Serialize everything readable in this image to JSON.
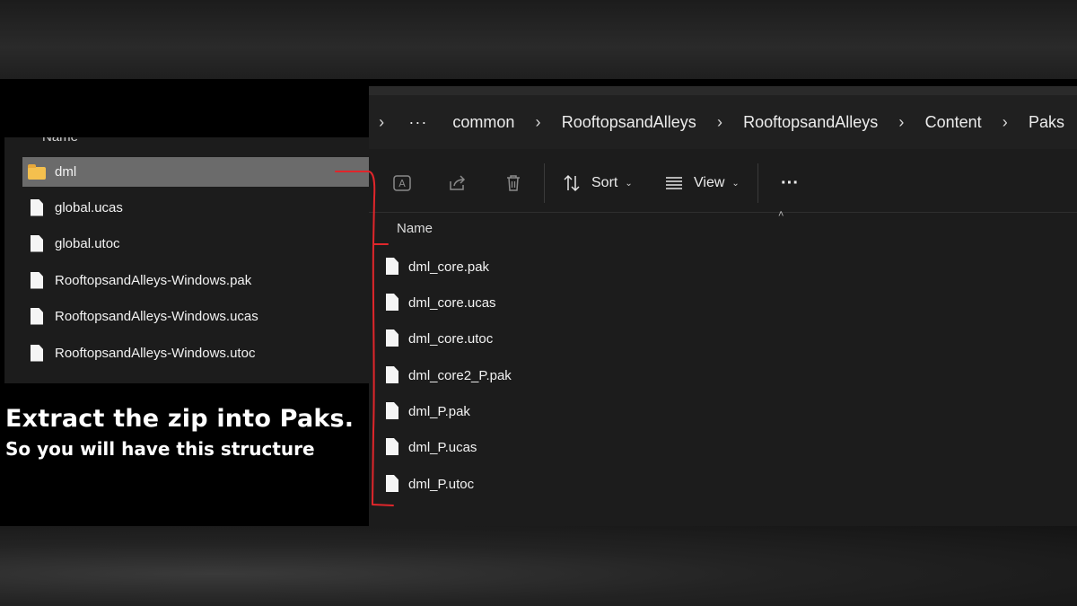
{
  "left_explorer": {
    "column_header": "Name",
    "items": [
      {
        "name": "dml",
        "type": "folder",
        "selected": true
      },
      {
        "name": "global.ucas",
        "type": "file"
      },
      {
        "name": "global.utoc",
        "type": "file"
      },
      {
        "name": "RooftopsandAlleys-Windows.pak",
        "type": "file"
      },
      {
        "name": "RooftopsandAlleys-Windows.ucas",
        "type": "file"
      },
      {
        "name": "RooftopsandAlleys-Windows.utoc",
        "type": "file"
      }
    ]
  },
  "caption": {
    "line1": "Extract the zip into Paks.",
    "line2": "So you will have this structure"
  },
  "right_explorer": {
    "breadcrumb": {
      "ellipsis": "···",
      "items": [
        "common",
        "RooftopsandAlleys",
        "RooftopsandAlleys",
        "Content",
        "Paks"
      ]
    },
    "toolbar": {
      "rename_icon": "rename-icon",
      "share_icon": "share-icon",
      "delete_icon": "trash-icon",
      "sort_label": "Sort",
      "view_label": "View",
      "more_label": "···"
    },
    "column_header": "Name",
    "files": [
      "dml_core.pak",
      "dml_core.ucas",
      "dml_core.utoc",
      "dml_core2_P.pak",
      "dml_P.pak",
      "dml_P.ucas",
      "dml_P.utoc"
    ]
  },
  "colors": {
    "annotation_red": "#e0262b",
    "folder_yellow": "#f4c04e",
    "selection_gray": "#6b6b6b"
  }
}
